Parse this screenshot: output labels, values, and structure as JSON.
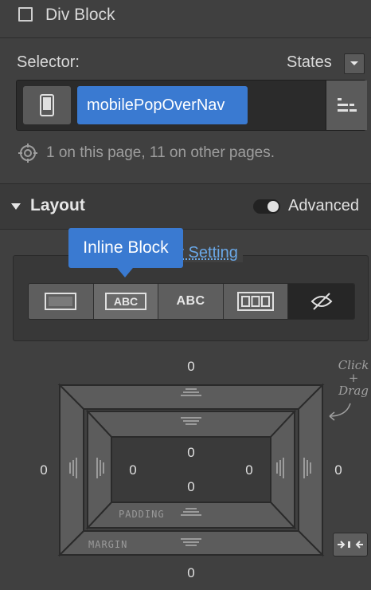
{
  "element": {
    "type_label": "Div Block"
  },
  "selector": {
    "label": "Selector:",
    "states_label": "States",
    "class_name": "mobilePopOverNav",
    "usage": "1 on this page, 11 on other pages."
  },
  "layout": {
    "title": "Layout",
    "advanced_label": "Advanced",
    "display_setting_label": "y Setting",
    "tooltip": "Inline Block",
    "display_options": [
      {
        "name": "block",
        "icon": "block-icon"
      },
      {
        "name": "inline-block",
        "icon": "inline-block-icon",
        "label": "ABC",
        "active": true
      },
      {
        "name": "inline",
        "icon": "inline-icon",
        "label": "ABC"
      },
      {
        "name": "flex",
        "icon": "flex-icon"
      },
      {
        "name": "none",
        "icon": "eye-slash-icon"
      }
    ]
  },
  "spacing": {
    "margin_label": "MARGIN",
    "padding_label": "PADDING",
    "margin": {
      "top": "0",
      "right": "0",
      "bottom": "0",
      "left": "0"
    },
    "padding": {
      "top": "0",
      "right": "0",
      "bottom": "0",
      "left": "0"
    },
    "hint": "Click + Drag"
  },
  "colors": {
    "panel_bg": "#404040",
    "accent": "#3a7ad1",
    "link": "#6aa8e8"
  }
}
